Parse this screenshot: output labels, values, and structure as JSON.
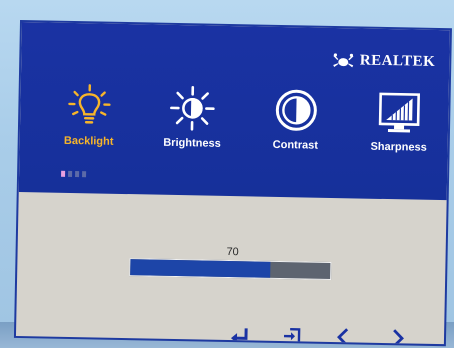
{
  "brand": {
    "name": "REALTEK",
    "logo_icon": "realtek-crab-logo"
  },
  "menu": {
    "items": [
      {
        "label": "Backlight",
        "icon": "lightbulb-icon",
        "active": true
      },
      {
        "label": "Brightness",
        "icon": "sun-icon",
        "active": false
      },
      {
        "label": "Contrast",
        "icon": "contrast-circle-icon",
        "active": false
      },
      {
        "label": "Sharpness",
        "icon": "monitor-sharpness-icon",
        "active": false
      }
    ],
    "page_indicator": {
      "count": 4,
      "current": 1
    }
  },
  "slider": {
    "value_text": "70",
    "value": 70,
    "max": 100
  },
  "nav": [
    {
      "icon": "enter-icon"
    },
    {
      "icon": "exit-icon"
    },
    {
      "icon": "chevron-left-icon"
    },
    {
      "icon": "chevron-right-icon"
    }
  ],
  "colors": {
    "panel_blue": "#1a32a3",
    "active_label": "#f7b52a",
    "bar_fill": "#1d45a8",
    "bar_track": "#5d6470"
  }
}
